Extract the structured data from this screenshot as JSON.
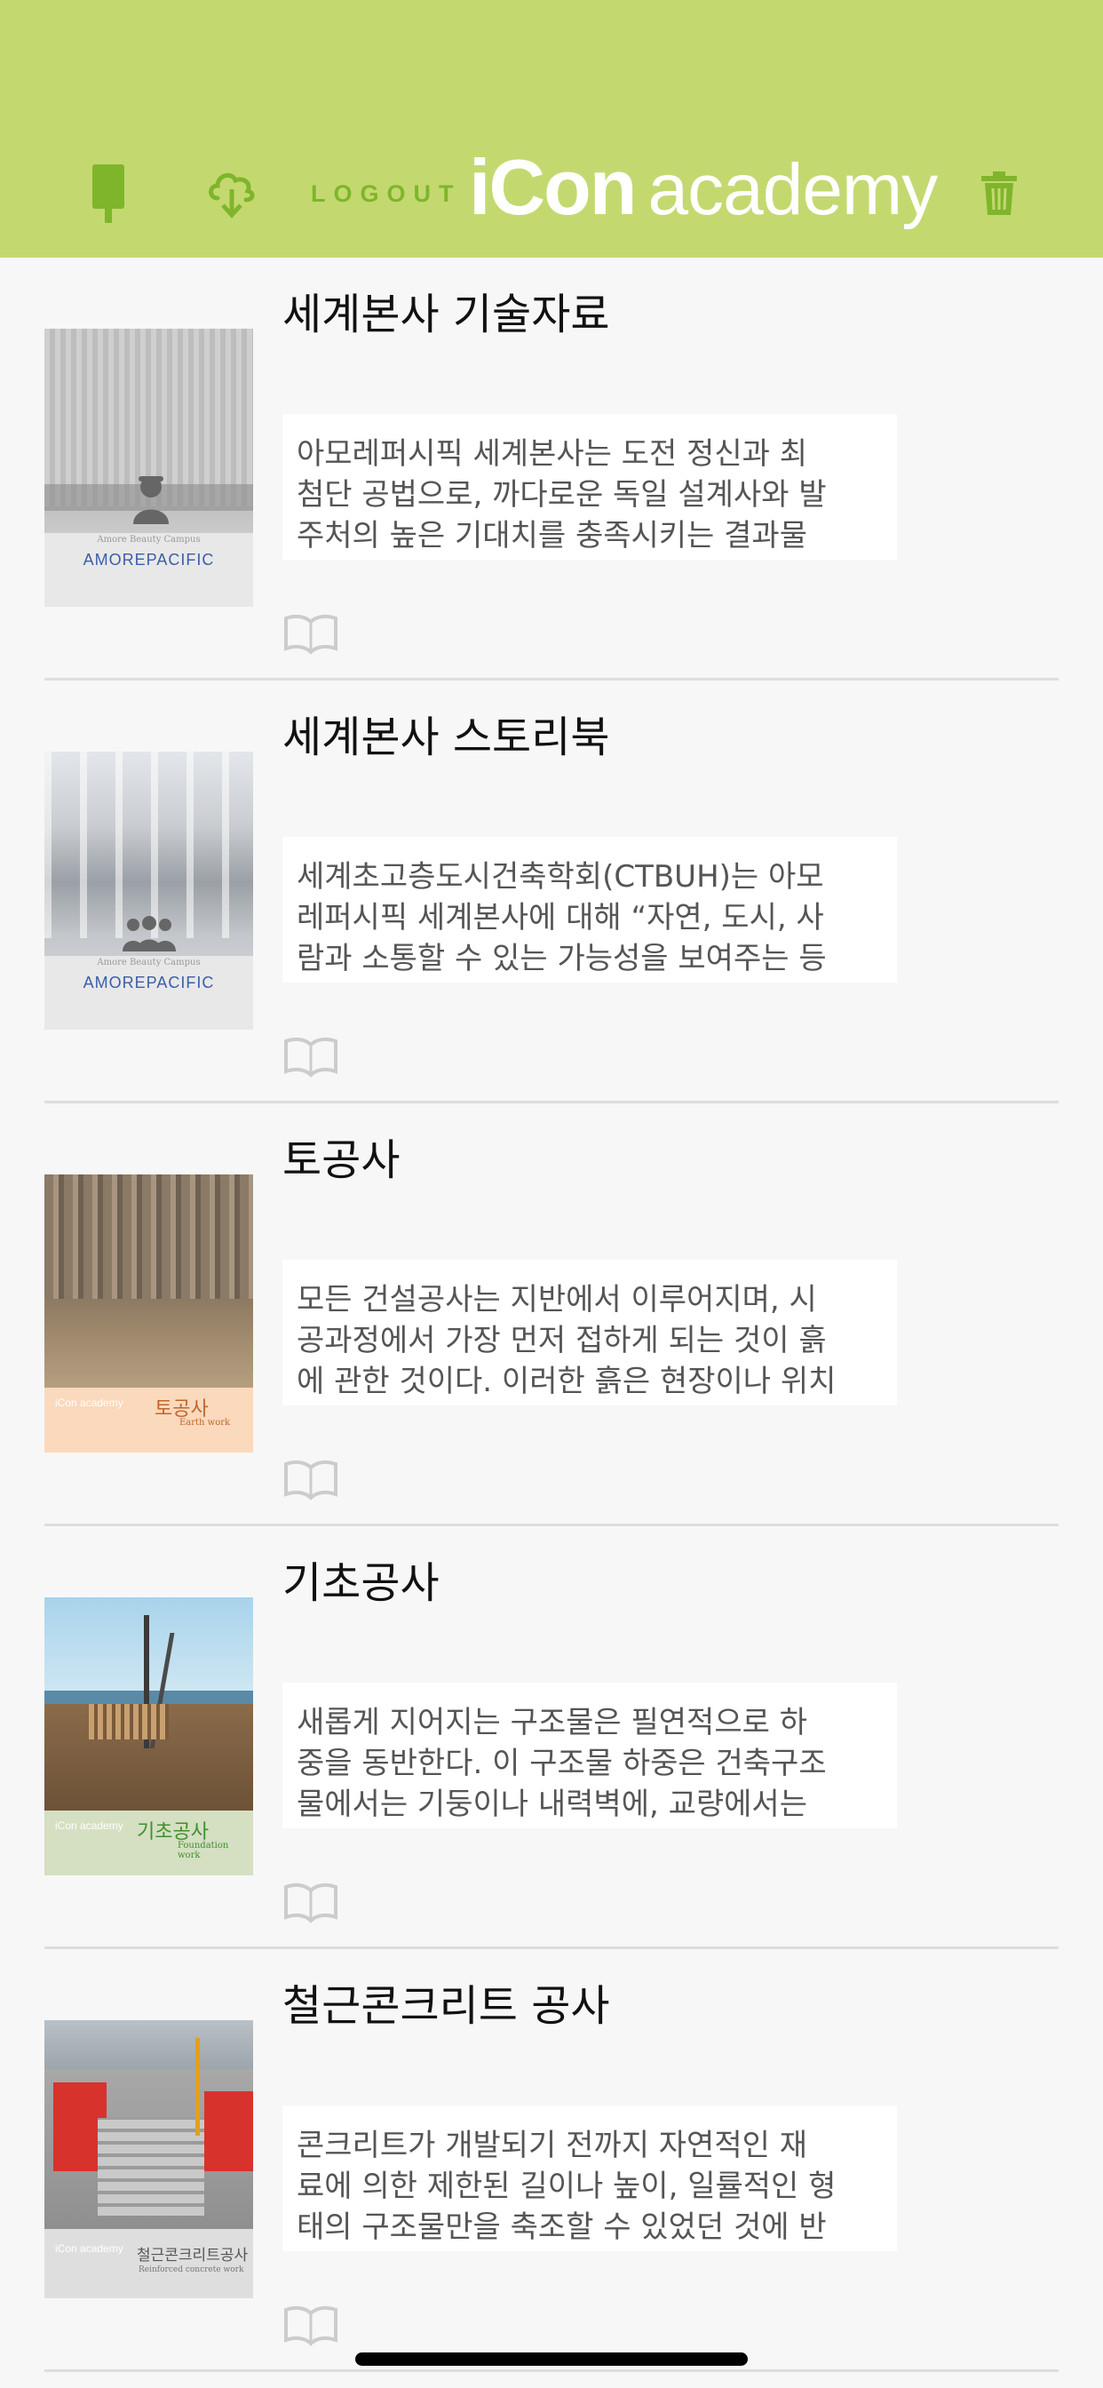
{
  "header": {
    "logout_label": "LOGOUT",
    "brand_icon": "iCon",
    "brand_academy": "academy",
    "icons": [
      "phone-icon",
      "cloud-download-icon",
      "trash-icon"
    ],
    "background_color": "#c3d970",
    "accent_color": "#7fb52b"
  },
  "items": [
    {
      "title": "세계본사 기술자료",
      "desc_lines": [
        "아모레퍼시픽 세계본사는 도전 정신과 최",
        "첨단 공법으로, 까다로운 독일 설계사와 발",
        "주처의 높은 기대치를 충족시키는 결과물"
      ],
      "thumb_brand": "AMOREPACIFIC",
      "thumb_subtitle": "Amore Beauty Campus"
    },
    {
      "title": "세계본사 스토리북",
      "desc_lines": [
        "세계초고층도시건축학회(CTBUH)는 아모",
        "레퍼시픽 세계본사에 대해 “자연, 도시, 사",
        "람과 소통할 수 있는 가능성을 보여주는 등"
      ],
      "thumb_brand": "AMOREPACIFIC",
      "thumb_subtitle": "Amore Beauty Campus"
    },
    {
      "title": "토공사",
      "desc_lines": [
        "모든 건설공사는 지반에서 이루어지며, 시",
        "공과정에서 가장 먼저 접하게 되는 것이 흙",
        "에 관한 것이다. 이러한 흙은 현장이나 위치"
      ],
      "thumb_app": "iCon academy",
      "thumb_title": "토공사",
      "thumb_en": "Earth work"
    },
    {
      "title": "기초공사",
      "desc_lines": [
        "새롭게 지어지는 구조물은 필연적으로 하",
        "중을 동반한다. 이 구조물 하중은 건축구조",
        "물에서는 기둥이나 내력벽에, 교량에서는"
      ],
      "thumb_app": "iCon academy",
      "thumb_title": "기초공사",
      "thumb_en": "Foundation work"
    },
    {
      "title": "철근콘크리트 공사",
      "desc_lines": [
        "콘크리트가 개발되기 전까지 자연적인 재",
        "료에 의한 제한된 길이나 높이, 일률적인 형",
        "태의  구조물만을 축조할 수 있었던 것에 반"
      ],
      "thumb_app": "iCon academy",
      "thumb_title": "철근콘크리트공사",
      "thumb_en": "Reinforced concrete work"
    }
  ]
}
